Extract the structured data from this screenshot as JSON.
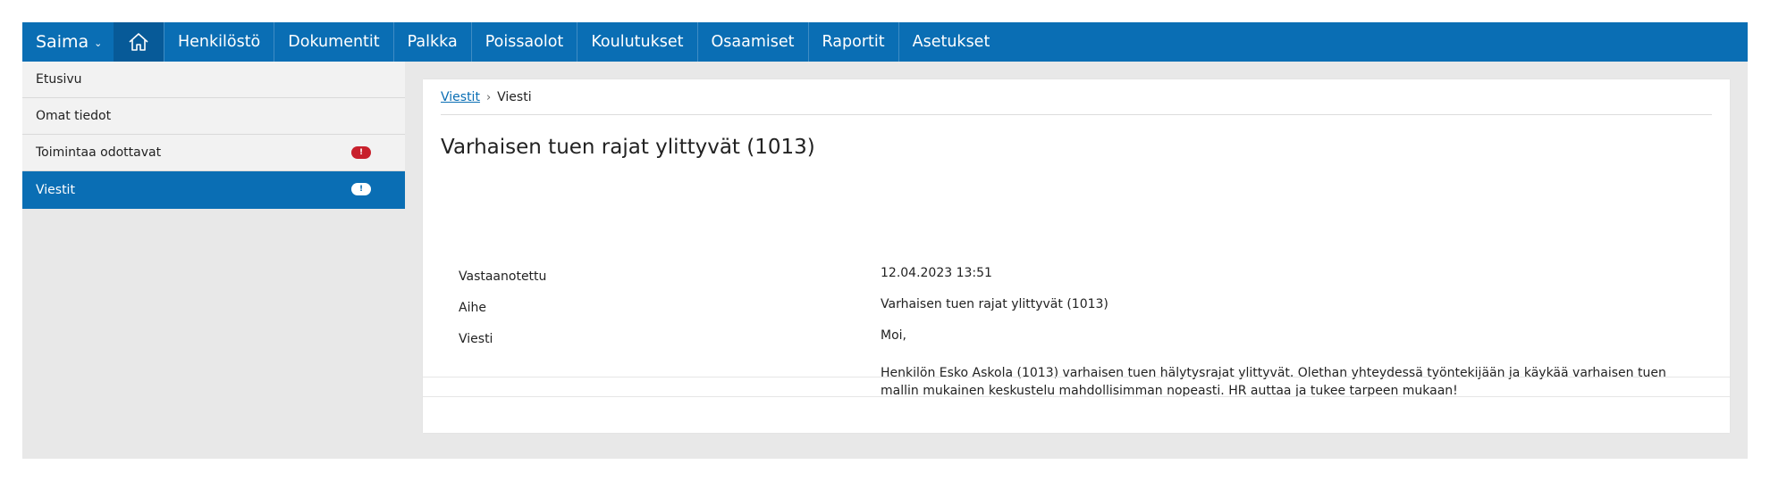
{
  "topnav": {
    "brand": "Saima",
    "home_icon": "home-icon",
    "items": [
      "Henkilöstö",
      "Dokumentit",
      "Palkka",
      "Poissaolot",
      "Koulutukset",
      "Osaamiset",
      "Raportit",
      "Asetukset"
    ]
  },
  "sidebar": {
    "items": [
      {
        "label": "Etusivu"
      },
      {
        "label": "Omat tiedot"
      },
      {
        "label": "Toimintaa odottavat",
        "badge": "!"
      },
      {
        "label": "Viestit",
        "badge": "!"
      }
    ]
  },
  "breadcrumb": {
    "link": "Viestit",
    "separator": "›",
    "current": "Viesti"
  },
  "message": {
    "title": "Varhaisen tuen rajat ylittyvät (1013)",
    "received_label": "Vastaanotettu",
    "received_value": "12.04.2023 13:51",
    "subject_label": "Aihe",
    "subject_value": "Varhaisen tuen rajat ylittyvät (1013)",
    "message_label": "Viesti",
    "greeting": "Moi,",
    "body": "Henkilön Esko Askola (1013) varhaisen tuen hälytysrajat ylittyvät. Olethan yhteydessä työntekijään ja käykää varhaisen tuen mallin mukainen keskustelu mahdollisimman nopeasti. HR auttaa ja tukee tarpeen mukaan!"
  },
  "colors": {
    "primary": "#0a6eb4",
    "badge_red": "#c8202c",
    "background": "#e8e8e8"
  }
}
